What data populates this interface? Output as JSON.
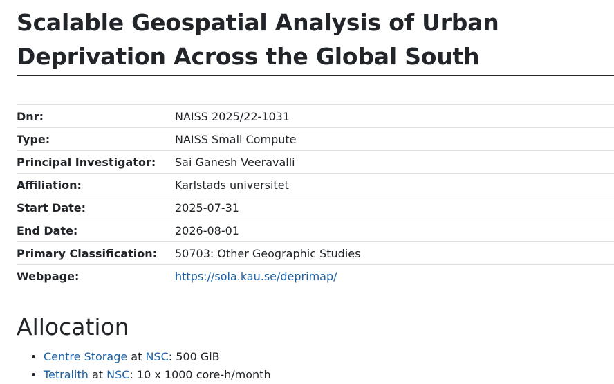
{
  "project": {
    "title": "Scalable Geospatial Analysis of Urban Deprivation Across the Global South"
  },
  "meta": {
    "rows": [
      {
        "label": "Dnr:",
        "value": "NAISS 2025/22-1031"
      },
      {
        "label": "Type:",
        "value": "NAISS Small Compute"
      },
      {
        "label": "Principal Investigator:",
        "value": "Sai Ganesh Veeravalli"
      },
      {
        "label": "Affiliation:",
        "value": "Karlstads universitet"
      },
      {
        "label": "Start Date:",
        "value": "2025-07-31"
      },
      {
        "label": "End Date:",
        "value": "2026-08-01"
      },
      {
        "label": "Primary Classification:",
        "value": "50703: Other Geographic Studies"
      },
      {
        "label": "Webpage:",
        "value": "https://sola.kau.se/deprimap/"
      }
    ]
  },
  "allocation": {
    "heading": "Allocation",
    "items": [
      {
        "resource": "Centre Storage",
        "at": " at ",
        "centre": "NSC",
        "amount": ": 500 GiB"
      },
      {
        "resource": "Tetralith",
        "at": " at ",
        "centre": "NSC",
        "amount": ": 10 x 1000 core-h/month"
      }
    ]
  },
  "colors": {
    "link": "#1a62a8",
    "text": "#212529",
    "row_border": "#dee2e6"
  }
}
